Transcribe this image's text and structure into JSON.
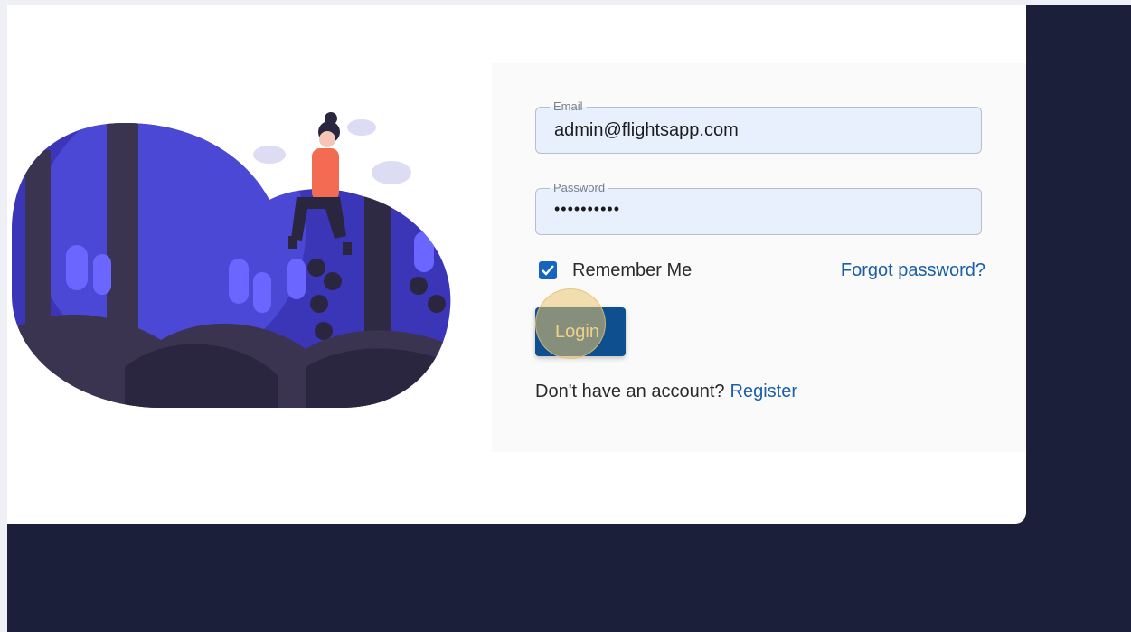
{
  "login_form": {
    "email": {
      "label": "Email",
      "value": "admin@flightsapp.com"
    },
    "password": {
      "label": "Password",
      "value": "••••••••••"
    },
    "remember_me": {
      "label": "Remember Me",
      "checked": true
    },
    "forgot_password_label": "Forgot password?",
    "login_label": "Login",
    "register_prompt": "Don't have an account?",
    "register_label": "Register"
  },
  "colors": {
    "background": "#1b1f3a",
    "accent": "#1565c0",
    "link": "#1a5fa8",
    "field_fill": "#e8f0fe",
    "illustration_purple": "#4b48d6",
    "figure_shirt": "#f26b52"
  }
}
